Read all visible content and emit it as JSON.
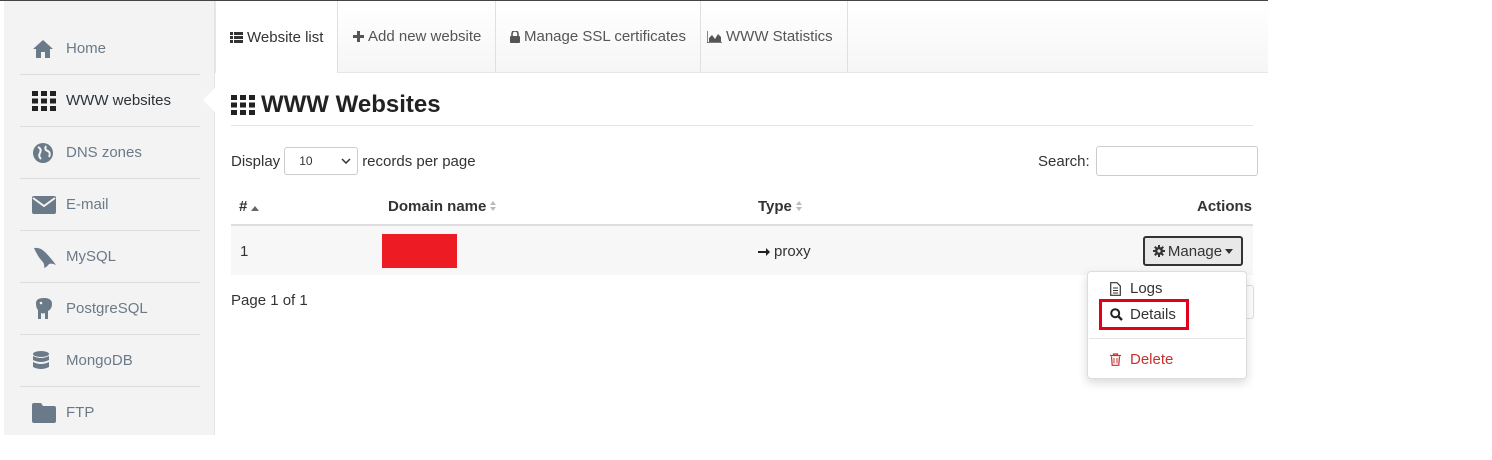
{
  "sidebar": {
    "items": [
      {
        "label": "Home",
        "icon": "home-icon"
      },
      {
        "label": "WWW websites",
        "icon": "grid-icon"
      },
      {
        "label": "DNS zones",
        "icon": "globe-icon"
      },
      {
        "label": "E-mail",
        "icon": "envelope-icon"
      },
      {
        "label": "MySQL",
        "icon": "dolphin-icon"
      },
      {
        "label": "PostgreSQL",
        "icon": "elephant-icon"
      },
      {
        "label": "MongoDB",
        "icon": "database-icon"
      },
      {
        "label": "FTP",
        "icon": "folder-icon"
      }
    ],
    "active_index": 1
  },
  "tabs": [
    {
      "label": "Website list",
      "icon": "list-icon"
    },
    {
      "label": "Add new website",
      "icon": "plus-icon"
    },
    {
      "label": "Manage SSL certificates",
      "icon": "lock-icon"
    },
    {
      "label": "WWW Statistics",
      "icon": "area-chart-icon"
    }
  ],
  "page": {
    "title": "WWW Websites"
  },
  "table_controls": {
    "display_label": "Display",
    "page_size": "10",
    "records_label": "records per page",
    "search_label": "Search:",
    "search_value": ""
  },
  "table": {
    "columns": [
      "#",
      "Domain name",
      "Type",
      "Actions"
    ],
    "rows": [
      {
        "index": "1",
        "domain": "",
        "type": "proxy",
        "action": "Manage"
      }
    ]
  },
  "pagination": {
    "info": "Page 1 of 1"
  },
  "dropdown": {
    "logs": "Logs",
    "details": "Details",
    "delete": "Delete"
  },
  "colors": {
    "accent": "#e3001b",
    "danger": "#c9302c",
    "redaction": "#ed1c24",
    "icon": "#6b7a88"
  }
}
